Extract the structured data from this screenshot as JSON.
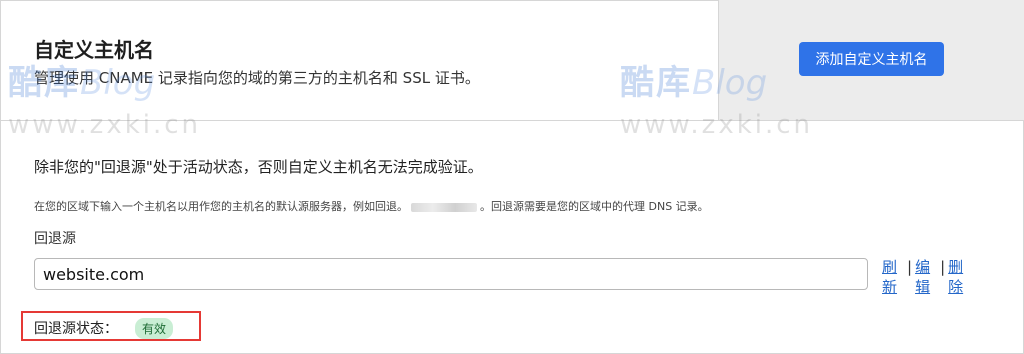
{
  "header": {
    "title": "自定义主机名",
    "subtitle": "管理使用 CNAME 记录指向您的域的第三方的主机名和 SSL 证书。",
    "add_button": "添加自定义主机名"
  },
  "fallback": {
    "warning": "除非您的\"回退源\"处于活动状态，否则自定义主机名无法完成验证。",
    "help_before": "在您的区域下输入一个主机名以用作您的主机名的默认源服务器，例如回退。",
    "help_after": "。回退源需要是您的区域中的代理 DNS 记录。",
    "label": "回退源",
    "value": "website.com",
    "actions": {
      "refresh": "刷新",
      "edit": "编辑",
      "delete": "删除"
    },
    "status_label": "回退源状态：",
    "status_value": "有效"
  },
  "watermark": {
    "brand_cn": "酷库",
    "brand_en": "Blog",
    "url": "www.zxki.cn"
  },
  "colors": {
    "accent": "#2f73e8",
    "link": "#2467c9",
    "status_bg": "#c9eed4",
    "highlight": "#e53935"
  }
}
